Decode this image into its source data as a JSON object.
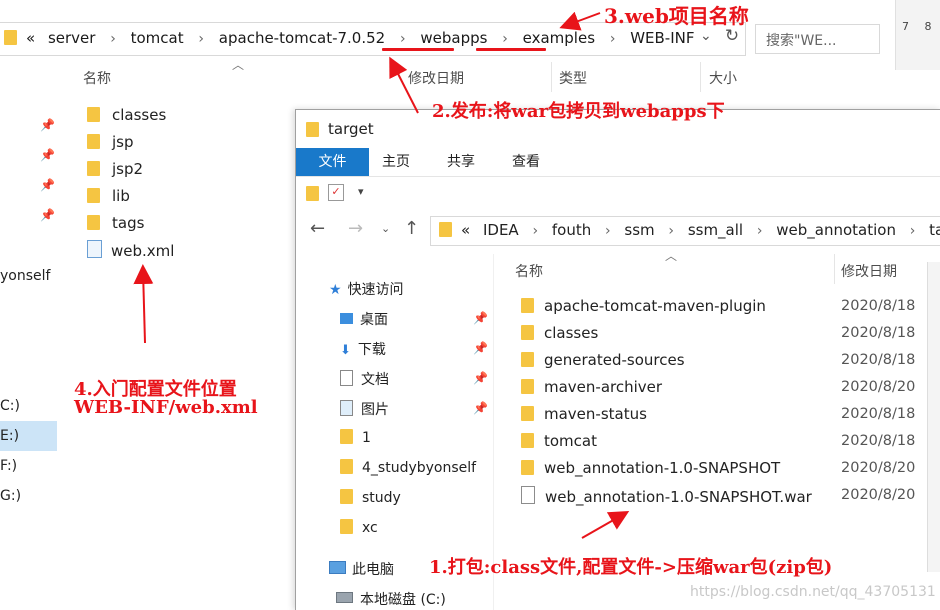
{
  "back_window": {
    "breadcrumb": [
      "«",
      "server",
      "tomcat",
      "apache-tomcat-7.0.52",
      "webapps",
      "examples",
      "WEB-INF"
    ],
    "search_placeholder": "搜索\"WE...",
    "column_name": "名称",
    "column_modified": "修改日期",
    "column_type": "类型",
    "column_size": "大小",
    "files": [
      {
        "name": "classes",
        "icon": "folder-icon"
      },
      {
        "name": "jsp",
        "icon": "folder-icon"
      },
      {
        "name": "jsp2",
        "icon": "folder-icon"
      },
      {
        "name": "lib",
        "icon": "folder-icon"
      },
      {
        "name": "tags",
        "icon": "folder-icon"
      },
      {
        "name": "web.xml",
        "icon": "xml-file-icon"
      }
    ],
    "left_items": [
      "yonself",
      "C:)",
      "E:)",
      "F:)",
      "G:)"
    ],
    "right_strip_numbers": "7 8"
  },
  "front_window": {
    "title": "target",
    "ribbon_tabs": [
      "文件",
      "主页",
      "共享",
      "查看"
    ],
    "breadcrumb": [
      "«",
      "IDEA",
      "fouth",
      "ssm",
      "ssm_all",
      "web_annotation",
      "target"
    ],
    "column_name": "名称",
    "column_modified": "修改日期",
    "nav": [
      {
        "label": "快速访问",
        "icon": "star-icon"
      },
      {
        "label": "桌面",
        "icon": "desktop-icon",
        "pinned": true
      },
      {
        "label": "下载",
        "icon": "download-icon",
        "pinned": true
      },
      {
        "label": "文档",
        "icon": "document-icon",
        "pinned": true
      },
      {
        "label": "图片",
        "icon": "picture-icon",
        "pinned": true
      },
      {
        "label": "1",
        "icon": "folder-icon"
      },
      {
        "label": "4_studybyonself",
        "icon": "folder-icon"
      },
      {
        "label": "study",
        "icon": "folder-icon"
      },
      {
        "label": "xc",
        "icon": "folder-icon"
      },
      {
        "label": "此电脑",
        "icon": "computer-icon"
      },
      {
        "label": "本地磁盘 (C:)",
        "icon": "drive-icon"
      }
    ],
    "files": [
      {
        "name": "apache-tomcat-maven-plugin",
        "date": "2020/8/18",
        "icon": "folder-icon"
      },
      {
        "name": "classes",
        "date": "2020/8/18",
        "icon": "folder-icon"
      },
      {
        "name": "generated-sources",
        "date": "2020/8/18",
        "icon": "folder-icon"
      },
      {
        "name": "maven-archiver",
        "date": "2020/8/20",
        "icon": "folder-icon"
      },
      {
        "name": "maven-status",
        "date": "2020/8/18",
        "icon": "folder-icon"
      },
      {
        "name": "tomcat",
        "date": "2020/8/18",
        "icon": "folder-icon"
      },
      {
        "name": "web_annotation-1.0-SNAPSHOT",
        "date": "2020/8/20",
        "icon": "folder-icon"
      },
      {
        "name": "web_annotation-1.0-SNAPSHOT.war",
        "date": "2020/8/20",
        "icon": "file-icon"
      }
    ]
  },
  "annotations": {
    "a1": "1.打包:class文件,配置文件->压缩war包(zip包)",
    "a2": "2.发布:将war包拷贝到webapps下",
    "a3": "3.web项目名称",
    "a4_line1": "4.入门配置文件位置",
    "a4_line2": "WEB-INF/web.xml"
  },
  "watermark": "https://blog.csdn.net/qq_43705131",
  "colors": {
    "annotation": "#e8141a",
    "ribbon_file_tab": "#1979ca",
    "folder": "#f5c542"
  }
}
